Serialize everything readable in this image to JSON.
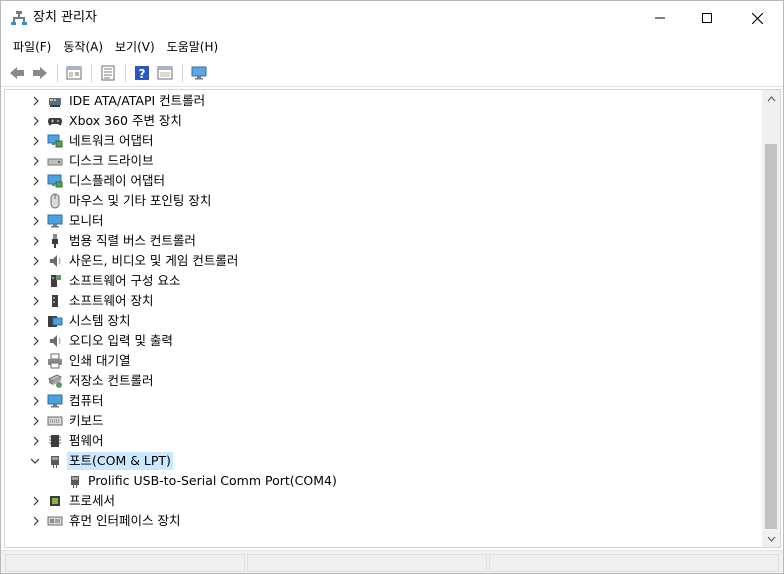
{
  "window": {
    "title": "장치 관리자"
  },
  "menu": [
    {
      "label": "파일(F)"
    },
    {
      "label": "동작(A)"
    },
    {
      "label": "보기(V)"
    },
    {
      "label": "도움말(H)"
    }
  ],
  "toolbar": {
    "buttons": [
      "back-icon",
      "forward-icon",
      "properties-pane-icon",
      "list-icon",
      "help-icon",
      "details-icon",
      "monitor-scan-icon"
    ]
  },
  "tree": {
    "items": [
      {
        "label": "IDE ATA/ATAPI 컨트롤러",
        "icon": "ide-controller-icon",
        "expanded": false
      },
      {
        "label": "Xbox 360 주변 장치",
        "icon": "gamepad-icon",
        "expanded": false
      },
      {
        "label": "네트워크 어댑터",
        "icon": "network-adapter-icon",
        "expanded": false
      },
      {
        "label": "디스크 드라이브",
        "icon": "disk-drive-icon",
        "expanded": false
      },
      {
        "label": "디스플레이 어댑터",
        "icon": "display-adapter-icon",
        "expanded": false
      },
      {
        "label": "마우스 및 기타 포인팅 장치",
        "icon": "mouse-icon",
        "expanded": false
      },
      {
        "label": "모니터",
        "icon": "monitor-icon",
        "expanded": false
      },
      {
        "label": "범용 직렬 버스 컨트롤러",
        "icon": "usb-icon",
        "expanded": false
      },
      {
        "label": "사운드, 비디오 및 게임 컨트롤러",
        "icon": "speaker-icon",
        "expanded": false
      },
      {
        "label": "소프트웨어 구성 요소",
        "icon": "software-component-icon",
        "expanded": false
      },
      {
        "label": "소프트웨어 장치",
        "icon": "software-device-icon",
        "expanded": false
      },
      {
        "label": "시스템 장치",
        "icon": "system-device-icon",
        "expanded": false
      },
      {
        "label": "오디오 입력 및 출력",
        "icon": "audio-io-icon",
        "expanded": false
      },
      {
        "label": "인쇄 대기열",
        "icon": "printer-icon",
        "expanded": false
      },
      {
        "label": "저장소 컨트롤러",
        "icon": "storage-controller-icon",
        "expanded": false
      },
      {
        "label": "컴퓨터",
        "icon": "computer-icon",
        "expanded": false
      },
      {
        "label": "키보드",
        "icon": "keyboard-icon",
        "expanded": false
      },
      {
        "label": "펌웨어",
        "icon": "firmware-icon",
        "expanded": false
      },
      {
        "label": "포트(COM & LPT)",
        "icon": "port-icon",
        "expanded": true,
        "selected": true,
        "children": [
          {
            "label": "Prolific USB-to-Serial Comm Port(COM4)",
            "icon": "port-icon"
          }
        ]
      },
      {
        "label": "프로세서",
        "icon": "processor-icon",
        "expanded": false
      },
      {
        "label": "휴먼 인터페이스 장치",
        "icon": "hid-icon",
        "expanded": false
      }
    ]
  }
}
